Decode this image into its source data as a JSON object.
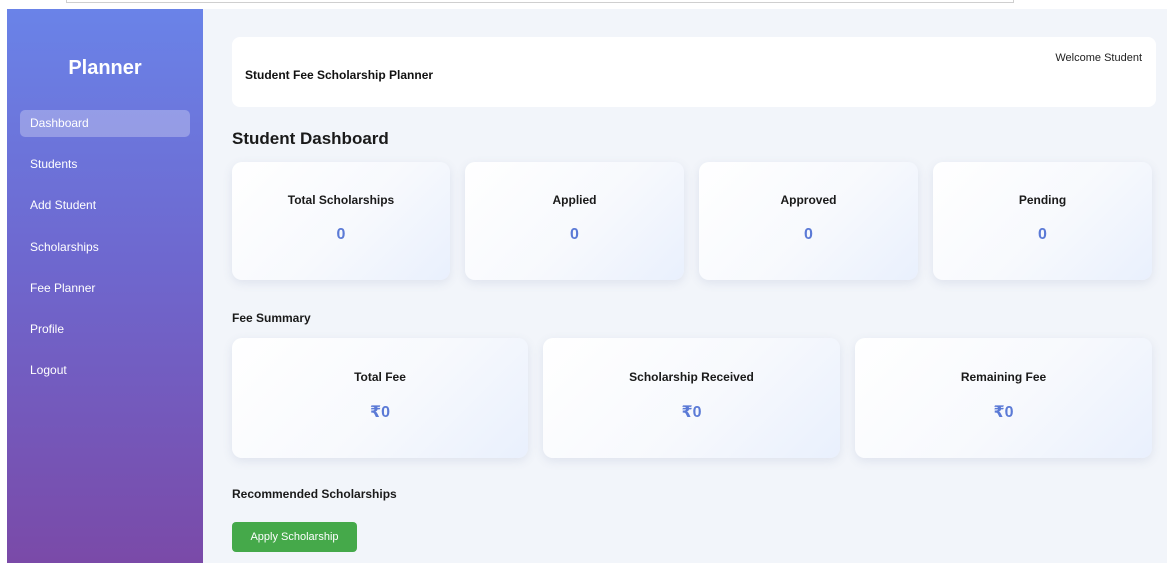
{
  "sidebar": {
    "title": "Planner",
    "items": [
      {
        "label": "Dashboard",
        "active": true
      },
      {
        "label": "Students"
      },
      {
        "label": "Add Student"
      },
      {
        "label": "Scholarships"
      },
      {
        "label": "Fee Planner"
      },
      {
        "label": "Profile"
      },
      {
        "label": "Logout"
      }
    ]
  },
  "header": {
    "title": "Student Fee Scholarship Planner",
    "welcome": "Welcome Student"
  },
  "main": {
    "page_title": "Student Dashboard",
    "stats": [
      {
        "label": "Total Scholarships",
        "value": "0"
      },
      {
        "label": "Applied",
        "value": "0"
      },
      {
        "label": "Approved",
        "value": "0"
      },
      {
        "label": "Pending",
        "value": "0"
      }
    ],
    "fee_summary_title": "Fee Summary",
    "fees": [
      {
        "label": "Total Fee",
        "value": "₹0"
      },
      {
        "label": "Scholarship Received",
        "value": "₹0"
      },
      {
        "label": "Remaining Fee",
        "value": "₹0"
      }
    ],
    "recommended_title": "Recommended Scholarships",
    "apply_button": "Apply Scholarship"
  },
  "colors": {
    "accent_value": "#5b7ad6",
    "apply_button": "#45a94a",
    "sidebar_top": "#6a83e8",
    "sidebar_bottom": "#7a4aa8"
  }
}
